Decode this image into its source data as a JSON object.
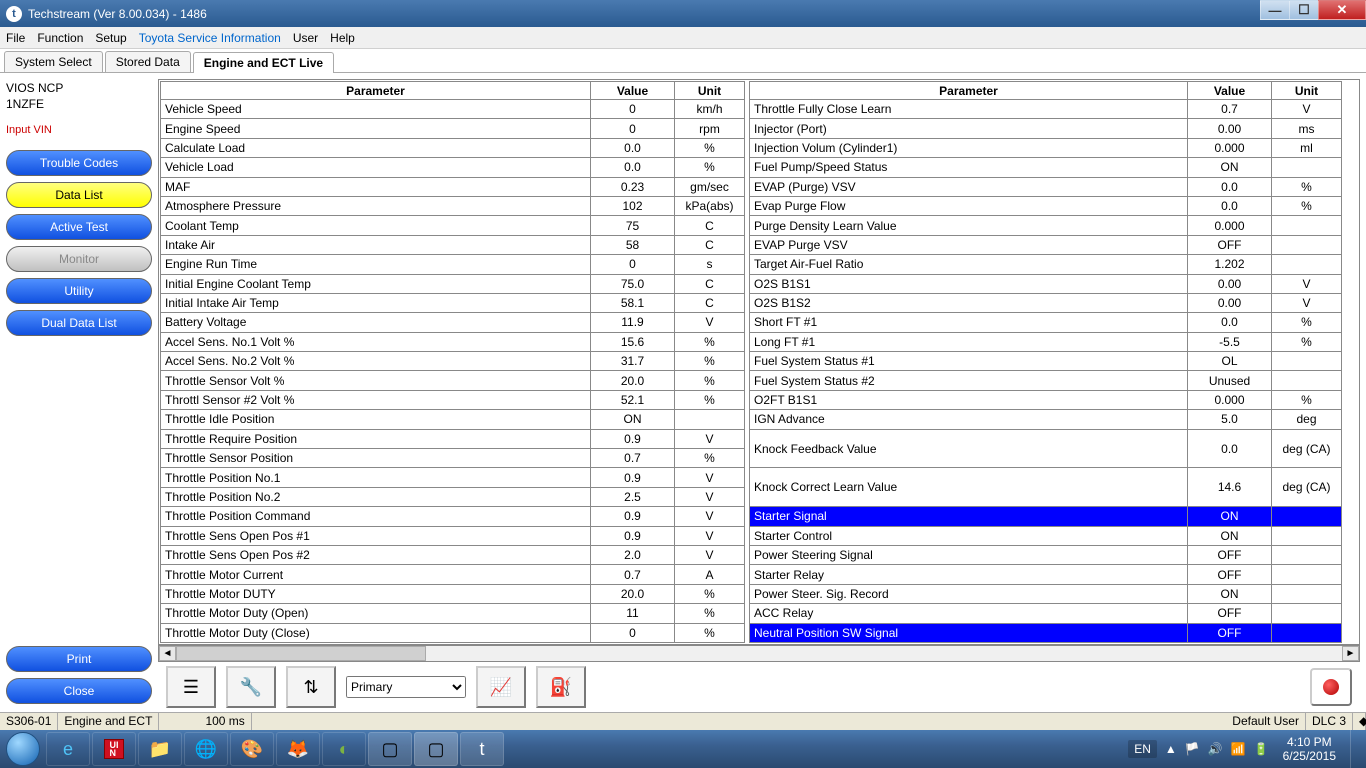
{
  "title": "Techstream (Ver 8.00.034) - 1486",
  "menu": [
    "File",
    "Function",
    "Setup",
    "Toyota Service Information",
    "User",
    "Help"
  ],
  "tabs": [
    "System Select",
    "Stored Data",
    "Engine and ECT Live"
  ],
  "active_tab": 2,
  "vehicle_line1": "VIOS NCP",
  "vehicle_line2": "1NZFE",
  "input_vin": "Input VIN",
  "side_buttons": [
    {
      "label": "Trouble Codes",
      "style": "blue"
    },
    {
      "label": "Data List",
      "style": "yellow"
    },
    {
      "label": "Active Test",
      "style": "blue"
    },
    {
      "label": "Monitor",
      "style": "grey"
    },
    {
      "label": "Utility",
      "style": "blue"
    },
    {
      "label": "Dual Data List",
      "style": "blue"
    }
  ],
  "bottom_buttons": [
    {
      "label": "Print",
      "style": "blue"
    },
    {
      "label": "Close",
      "style": "blue"
    }
  ],
  "columns": {
    "param": "Parameter",
    "value": "Value",
    "unit": "Unit"
  },
  "left_table": [
    {
      "p": "Vehicle Speed",
      "v": "0",
      "u": "km/h"
    },
    {
      "p": "Engine Speed",
      "v": "0",
      "u": "rpm"
    },
    {
      "p": "Calculate Load",
      "v": "0.0",
      "u": "%"
    },
    {
      "p": "Vehicle Load",
      "v": "0.0",
      "u": "%"
    },
    {
      "p": "MAF",
      "v": "0.23",
      "u": "gm/sec"
    },
    {
      "p": "Atmosphere Pressure",
      "v": "102",
      "u": "kPa(abs)"
    },
    {
      "p": "Coolant Temp",
      "v": "75",
      "u": "C"
    },
    {
      "p": "Intake Air",
      "v": "58",
      "u": "C"
    },
    {
      "p": "Engine Run Time",
      "v": "0",
      "u": "s"
    },
    {
      "p": "Initial Engine Coolant Temp",
      "v": "75.0",
      "u": "C"
    },
    {
      "p": "Initial Intake Air Temp",
      "v": "58.1",
      "u": "C"
    },
    {
      "p": "Battery Voltage",
      "v": "11.9",
      "u": "V"
    },
    {
      "p": "Accel Sens. No.1 Volt %",
      "v": "15.6",
      "u": "%"
    },
    {
      "p": "Accel Sens. No.2 Volt %",
      "v": "31.7",
      "u": "%"
    },
    {
      "p": "Throttle Sensor Volt %",
      "v": "20.0",
      "u": "%"
    },
    {
      "p": "Throttl Sensor #2 Volt %",
      "v": "52.1",
      "u": "%"
    },
    {
      "p": "Throttle Idle Position",
      "v": "ON",
      "u": ""
    },
    {
      "p": "Throttle Require Position",
      "v": "0.9",
      "u": "V"
    },
    {
      "p": "Throttle Sensor Position",
      "v": "0.7",
      "u": "%"
    },
    {
      "p": "Throttle Position No.1",
      "v": "0.9",
      "u": "V"
    },
    {
      "p": "Throttle Position No.2",
      "v": "2.5",
      "u": "V"
    },
    {
      "p": "Throttle Position Command",
      "v": "0.9",
      "u": "V"
    },
    {
      "p": "Throttle Sens Open Pos #1",
      "v": "0.9",
      "u": "V"
    },
    {
      "p": "Throttle Sens Open Pos #2",
      "v": "2.0",
      "u": "V"
    },
    {
      "p": "Throttle Motor Current",
      "v": "0.7",
      "u": "A"
    },
    {
      "p": "Throttle Motor DUTY",
      "v": "20.0",
      "u": "%"
    },
    {
      "p": "Throttle Motor Duty (Open)",
      "v": "11",
      "u": "%"
    },
    {
      "p": "Throttle Motor Duty (Close)",
      "v": "0",
      "u": "%"
    }
  ],
  "right_table": [
    {
      "p": "Throttle Fully Close Learn",
      "v": "0.7",
      "u": "V"
    },
    {
      "p": "Injector (Port)",
      "v": "0.00",
      "u": "ms"
    },
    {
      "p": "Injection Volum (Cylinder1)",
      "v": "0.000",
      "u": "ml"
    },
    {
      "p": "Fuel Pump/Speed Status",
      "v": "ON",
      "u": ""
    },
    {
      "p": "EVAP (Purge) VSV",
      "v": "0.0",
      "u": "%"
    },
    {
      "p": "Evap Purge Flow",
      "v": "0.0",
      "u": "%"
    },
    {
      "p": "Purge Density Learn Value",
      "v": "0.000",
      "u": ""
    },
    {
      "p": "EVAP Purge VSV",
      "v": "OFF",
      "u": ""
    },
    {
      "p": "Target Air-Fuel Ratio",
      "v": "1.202",
      "u": ""
    },
    {
      "p": "O2S B1S1",
      "v": "0.00",
      "u": "V"
    },
    {
      "p": "O2S B1S2",
      "v": "0.00",
      "u": "V"
    },
    {
      "p": "Short FT #1",
      "v": "0.0",
      "u": "%"
    },
    {
      "p": "Long FT #1",
      "v": "-5.5",
      "u": "%"
    },
    {
      "p": "Fuel System Status #1",
      "v": "OL",
      "u": ""
    },
    {
      "p": "Fuel System Status #2",
      "v": "Unused",
      "u": ""
    },
    {
      "p": "O2FT B1S1",
      "v": "0.000",
      "u": "%"
    },
    {
      "p": "IGN Advance",
      "v": "5.0",
      "u": "deg"
    },
    {
      "p": "Knock Feedback Value",
      "v": "0.0",
      "u": "deg (CA)",
      "tall": true
    },
    {
      "p": "Knock Correct Learn Value",
      "v": "14.6",
      "u": "deg (CA)",
      "tall": true
    },
    {
      "p": "Starter Signal",
      "v": "ON",
      "u": "",
      "sel": true
    },
    {
      "p": "Starter Control",
      "v": "ON",
      "u": ""
    },
    {
      "p": "Power Steering Signal",
      "v": "OFF",
      "u": ""
    },
    {
      "p": "Starter Relay",
      "v": "OFF",
      "u": ""
    },
    {
      "p": "Power Steer. Sig. Record",
      "v": "ON",
      "u": ""
    },
    {
      "p": "ACC Relay",
      "v": "OFF",
      "u": ""
    },
    {
      "p": "Neutral Position SW Signal",
      "v": "OFF",
      "u": "",
      "sel": true
    }
  ],
  "dropdown": "Primary",
  "status": {
    "left1": "S306-01",
    "left2": "Engine and ECT",
    "left3": "100 ms",
    "right1": "Default User",
    "right2": "DLC 3"
  },
  "systray": {
    "lang": "EN",
    "time": "4:10 PM",
    "date": "6/25/2015"
  }
}
